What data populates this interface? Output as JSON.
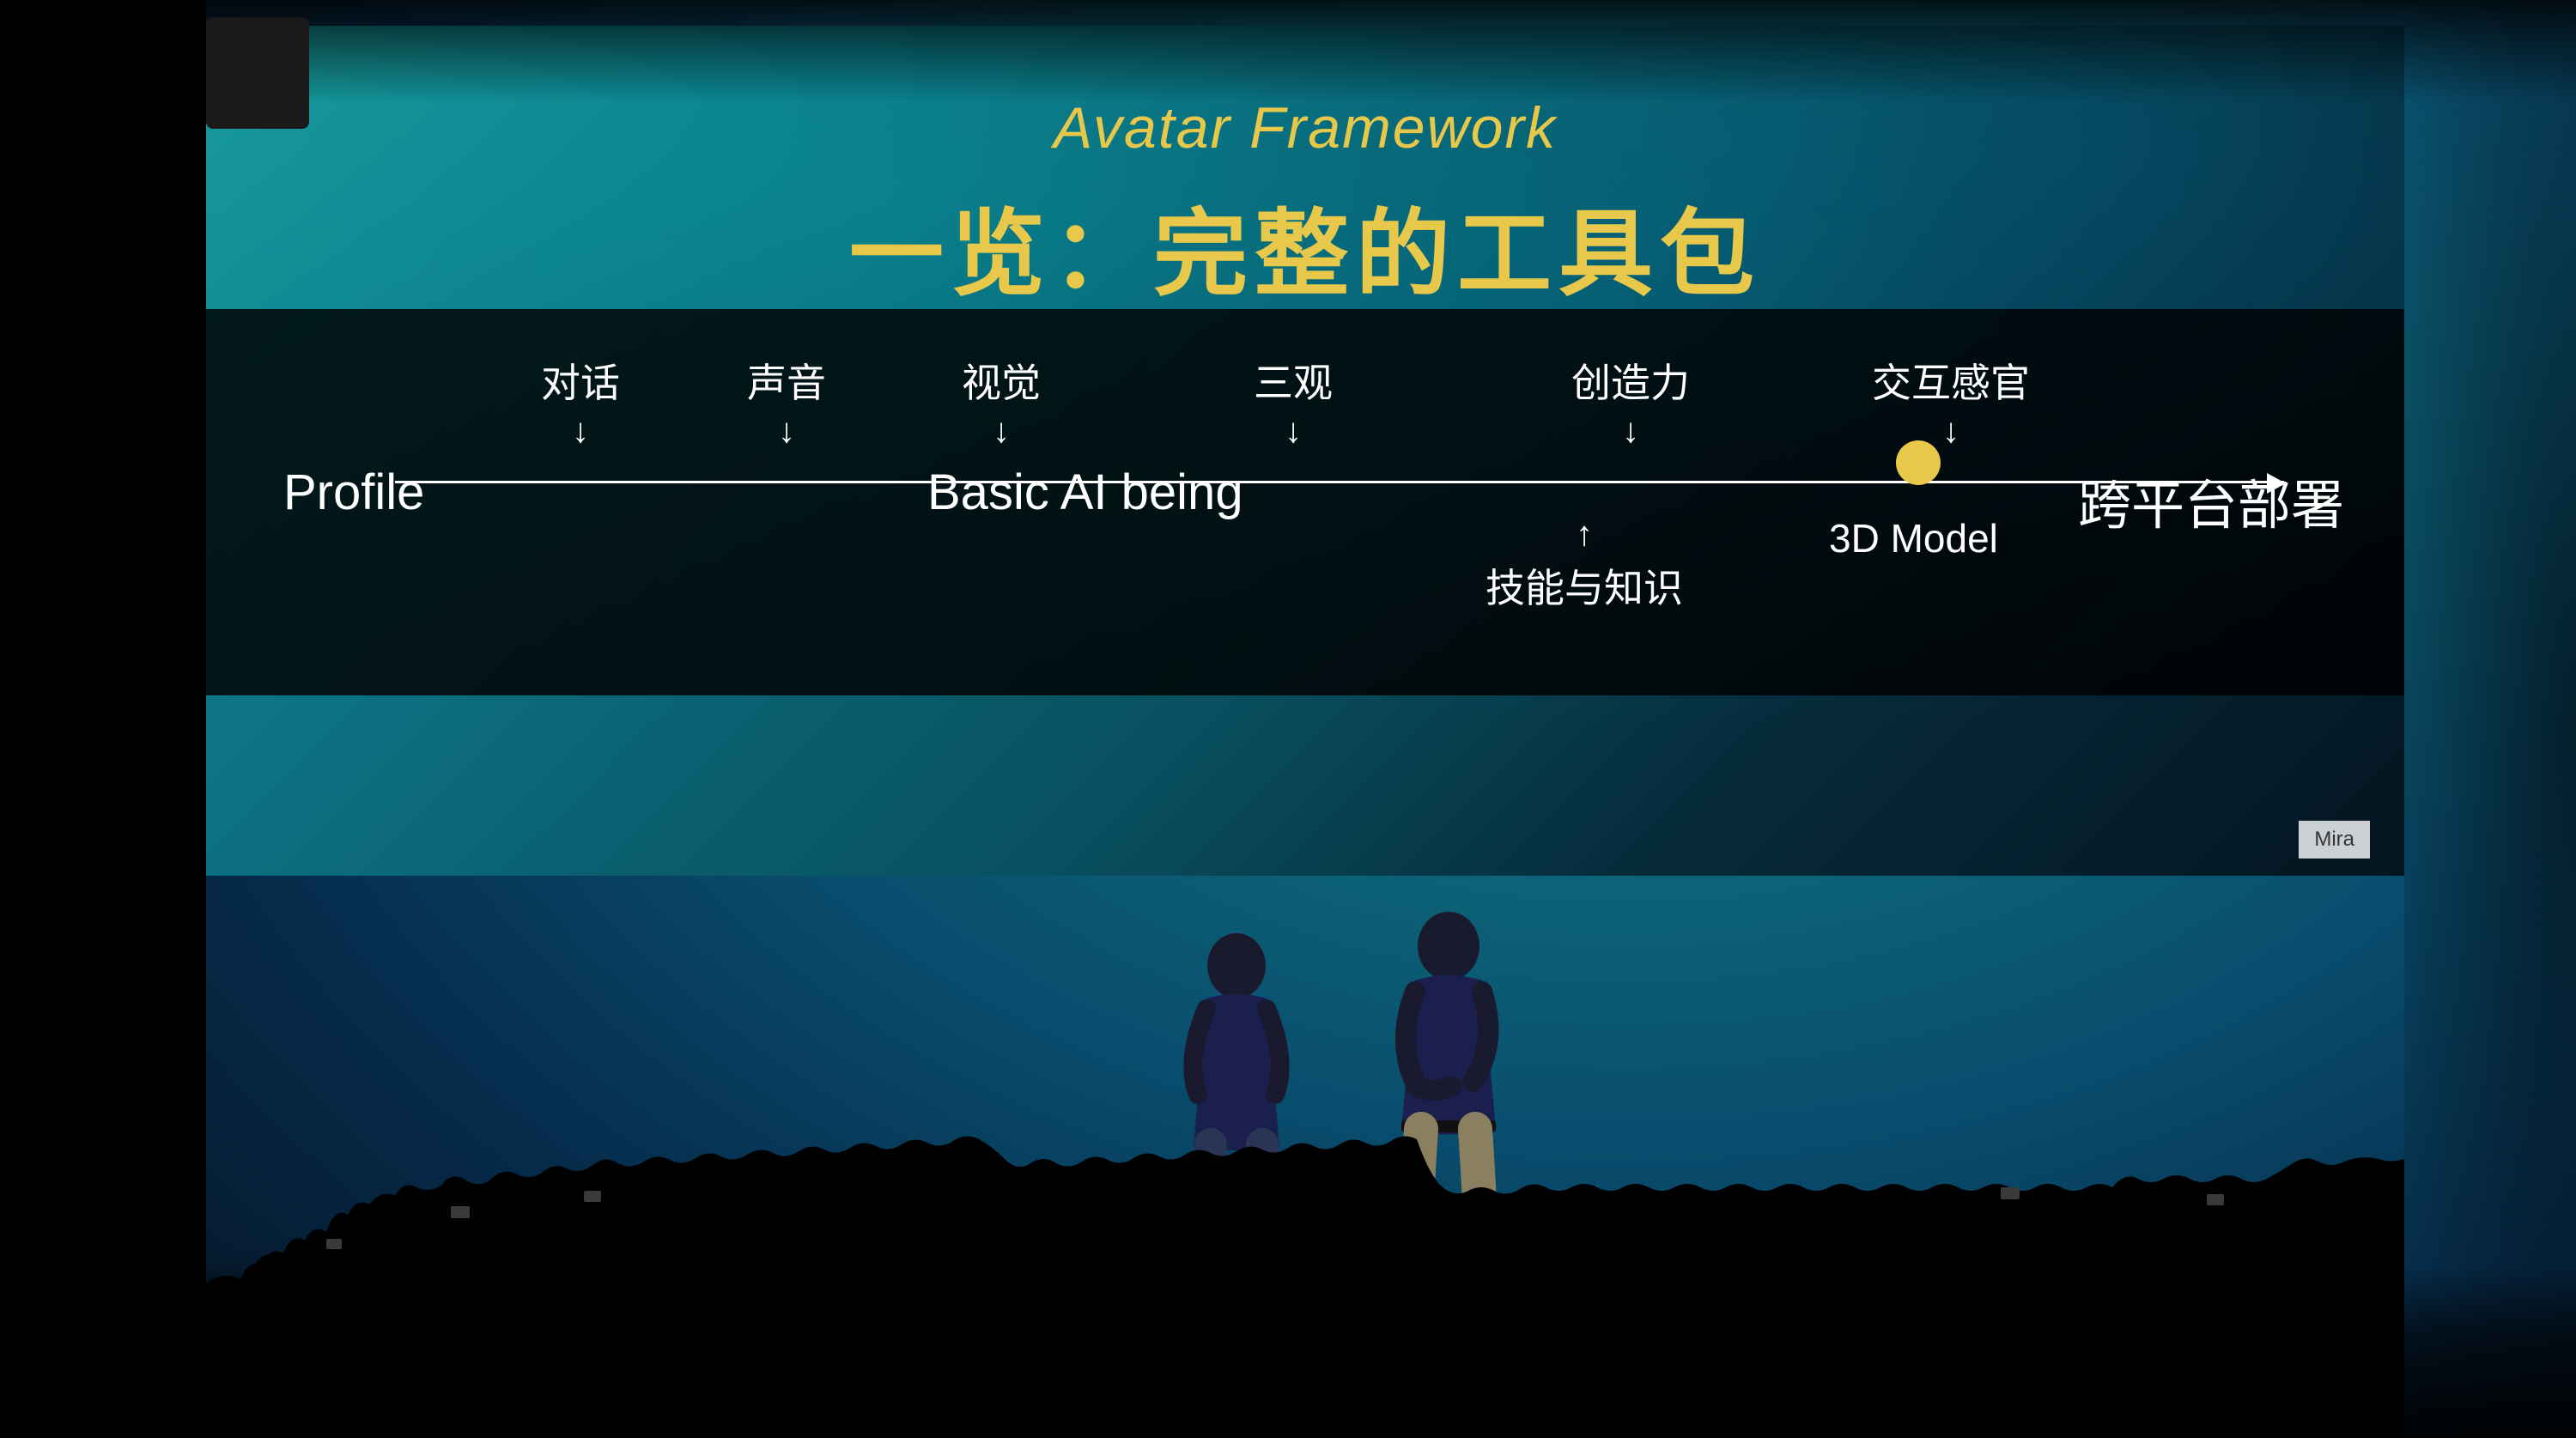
{
  "scene": {
    "title_english": "Avatar Framework",
    "title_chinese": "一览：完整的工具包",
    "diagram": {
      "label_profile": "Profile",
      "label_basic_ai": "Basic AI being",
      "label_cross_platform": "跨平台部署",
      "label_3d_model": "3D Model",
      "above_labels": [
        {
          "id": "duihua",
          "text": "对话",
          "left_pct": 16
        },
        {
          "id": "shengyin",
          "text": "声音",
          "left_pct": 24
        },
        {
          "id": "shijue",
          "text": "视觉",
          "left_pct": 32
        },
        {
          "id": "sanguan",
          "text": "三观",
          "left_pct": 48
        },
        {
          "id": "chuangzaoli",
          "text": "创造力",
          "left_pct": 61
        },
        {
          "id": "jiaohuganguan",
          "text": "交互感官",
          "left_pct": 74
        }
      ],
      "below_labels": [
        {
          "id": "jineng",
          "text": "技能与知识",
          "left_pct": 58
        },
        {
          "id": "model3d",
          "text": "3D Model",
          "left_pct": 70
        }
      ]
    }
  }
}
